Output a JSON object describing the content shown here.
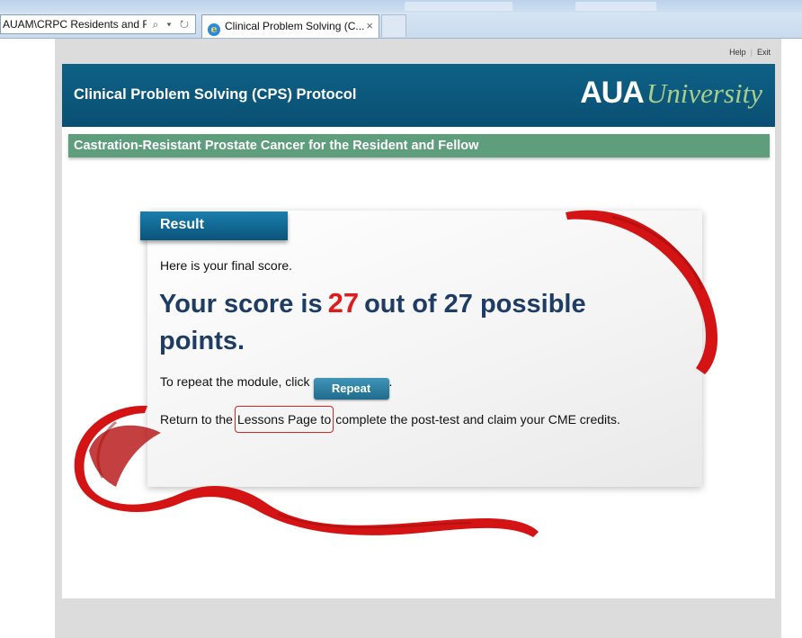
{
  "browser": {
    "address_text": "AUAM\\CRPC Residents and Fel",
    "tab_title": "Clinical Problem Solving (C...",
    "tab_close": "×",
    "address_icons": "⌕ ▾ ↻"
  },
  "toplinks": {
    "help": "Help",
    "exit": "Exit"
  },
  "header": {
    "title": "Clinical Problem Solving (CPS) Protocol",
    "logo_aua": "AUA",
    "logo_university": "University"
  },
  "subheader": {
    "title": "Castration-Resistant Prostate Cancer for the Resident and Fellow"
  },
  "result": {
    "tab_label": "Result",
    "intro": "Here is your final score.",
    "score_prefix": "Your score is",
    "score_value": "27",
    "score_suffix": "out of 27 possible points.",
    "repeat_prefix": "To repeat the module, click",
    "repeat_button": "Repeat",
    "repeat_suffix": ".",
    "lessons_prefix": "Return to the",
    "lessons_link": "Lessons Page to",
    "lessons_suffix": "complete the post-test and claim your CME credits."
  },
  "colors": {
    "header_blue": "#0a5479",
    "subheader_green": "#5e9e7c",
    "score_red": "#e01b1b",
    "score_text": "#1e3c64",
    "ribbon_red": "#d41414"
  }
}
